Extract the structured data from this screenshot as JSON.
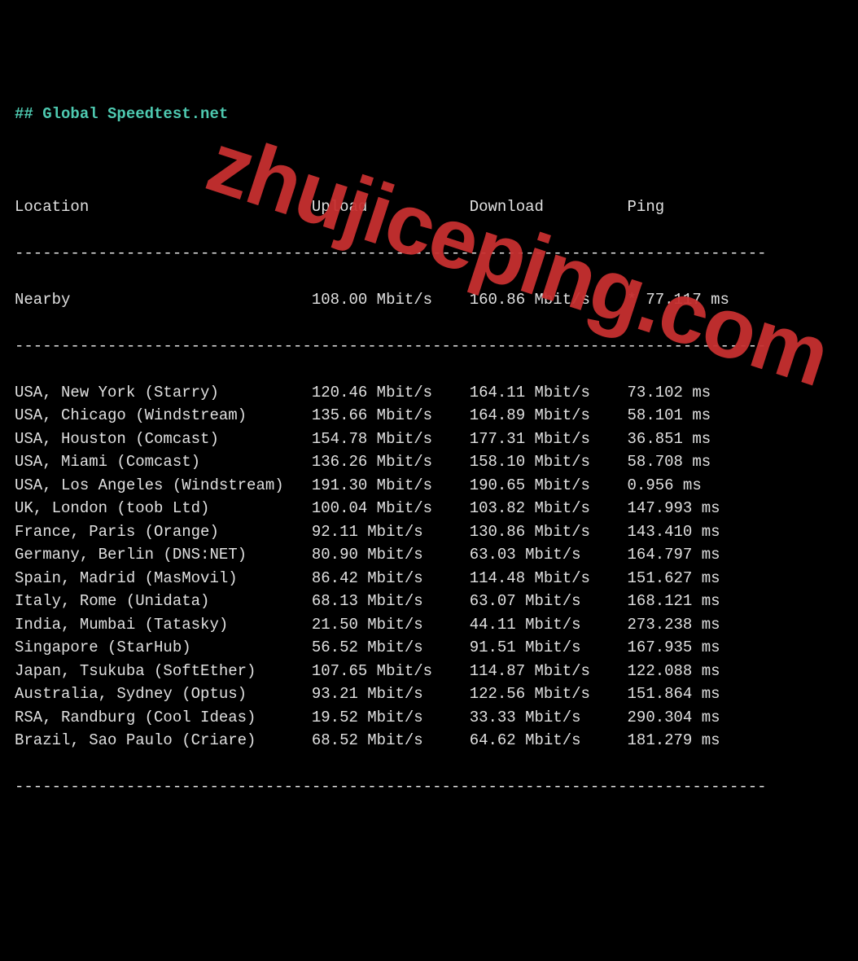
{
  "title": "## Global Speedtest.net",
  "watermark": "zhujiceping.com",
  "headers": {
    "location": "Location",
    "upload": "Upload",
    "download": "Download",
    "ping": "Ping"
  },
  "nearby": {
    "location": "Nearby",
    "upload": "108.00 Mbit/s",
    "download": "160.86 Mbit/s",
    "ping": "* 77.117 ms"
  },
  "rows": [
    {
      "location": "USA, New York (Starry)",
      "upload": "120.46 Mbit/s",
      "download": "164.11 Mbit/s",
      "ping": "73.102 ms"
    },
    {
      "location": "USA, Chicago (Windstream)",
      "upload": "135.66 Mbit/s",
      "download": "164.89 Mbit/s",
      "ping": "58.101 ms"
    },
    {
      "location": "USA, Houston (Comcast)",
      "upload": "154.78 Mbit/s",
      "download": "177.31 Mbit/s",
      "ping": "36.851 ms"
    },
    {
      "location": "USA, Miami (Comcast)",
      "upload": "136.26 Mbit/s",
      "download": "158.10 Mbit/s",
      "ping": "58.708 ms"
    },
    {
      "location": "USA, Los Angeles (Windstream)",
      "upload": "191.30 Mbit/s",
      "download": "190.65 Mbit/s",
      "ping": "0.956 ms"
    },
    {
      "location": "UK, London (toob Ltd)",
      "upload": "100.04 Mbit/s",
      "download": "103.82 Mbit/s",
      "ping": "147.993 ms"
    },
    {
      "location": "France, Paris (Orange)",
      "upload": "92.11 Mbit/s",
      "download": "130.86 Mbit/s",
      "ping": "143.410 ms"
    },
    {
      "location": "Germany, Berlin (DNS:NET)",
      "upload": "80.90 Mbit/s",
      "download": "63.03 Mbit/s",
      "ping": "164.797 ms"
    },
    {
      "location": "Spain, Madrid (MasMovil)",
      "upload": "86.42 Mbit/s",
      "download": "114.48 Mbit/s",
      "ping": "151.627 ms"
    },
    {
      "location": "Italy, Rome (Unidata)",
      "upload": "68.13 Mbit/s",
      "download": "63.07 Mbit/s",
      "ping": "168.121 ms"
    },
    {
      "location": "India, Mumbai (Tatasky)",
      "upload": "21.50 Mbit/s",
      "download": "44.11 Mbit/s",
      "ping": "273.238 ms"
    },
    {
      "location": "Singapore (StarHub)",
      "upload": "56.52 Mbit/s",
      "download": "91.51 Mbit/s",
      "ping": "167.935 ms"
    },
    {
      "location": "Japan, Tsukuba (SoftEther)",
      "upload": "107.65 Mbit/s",
      "download": "114.87 Mbit/s",
      "ping": "122.088 ms"
    },
    {
      "location": "Australia, Sydney (Optus)",
      "upload": "93.21 Mbit/s",
      "download": "122.56 Mbit/s",
      "ping": "151.864 ms"
    },
    {
      "location": "RSA, Randburg (Cool Ideas)",
      "upload": "19.52 Mbit/s",
      "download": "33.33 Mbit/s",
      "ping": "290.304 ms"
    },
    {
      "location": "Brazil, Sao Paulo (Criare)",
      "upload": "68.52 Mbit/s",
      "download": "64.62 Mbit/s",
      "ping": "181.279 ms"
    }
  ],
  "divider": "---------------------------------------------------------------------------------",
  "col_widths": {
    "location": 32,
    "upload": 17,
    "download": 17,
    "ping": 15
  }
}
